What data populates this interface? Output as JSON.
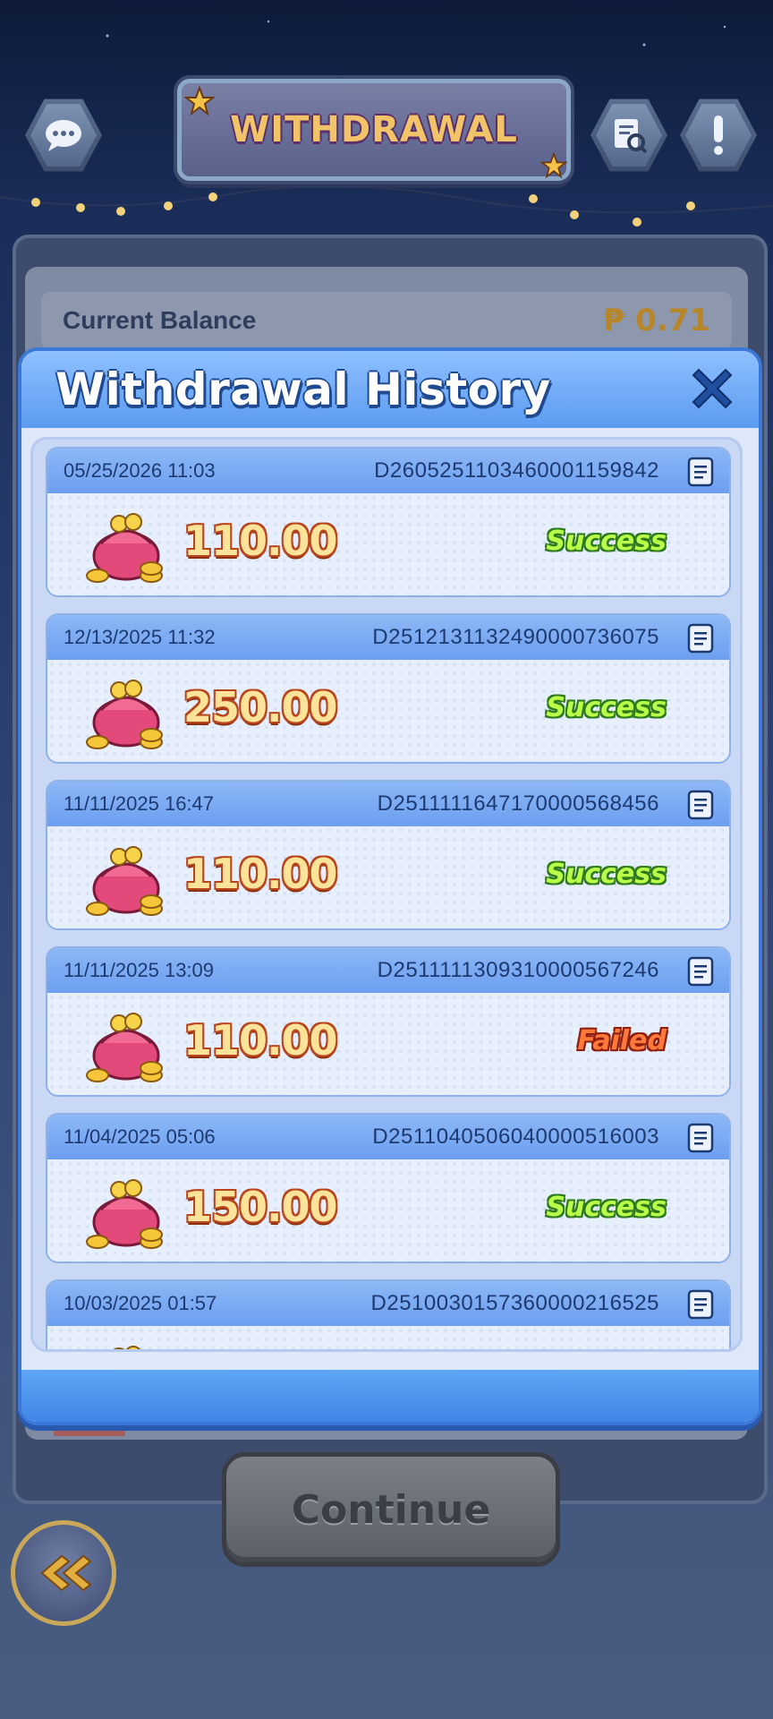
{
  "screen": {
    "title": "WITHDRAWAL",
    "balance_label": "Current Balance",
    "balance_value": "₱ 0.71",
    "continue_label": "Continue"
  },
  "modal": {
    "title": "Withdrawal History",
    "records": [
      {
        "date": "05/25/2026 11:03",
        "id": "D260525110346000115984​2",
        "amount": "110.00",
        "status": "Success"
      },
      {
        "date": "12/13/2025 11:32",
        "id": "D251213113249000073607​5",
        "amount": "250.00",
        "status": "Success"
      },
      {
        "date": "11/11/2025 16:47",
        "id": "D251111164717000056845​6",
        "amount": "110.00",
        "status": "Success"
      },
      {
        "date": "11/11/2025 13:09",
        "id": "D251111130931000056724​6",
        "amount": "110.00",
        "status": "Failed"
      },
      {
        "date": "11/04/2025 05:06",
        "id": "D251104050604000051600​3",
        "amount": "150.00",
        "status": "Success"
      },
      {
        "date": "10/03/2025 01:57",
        "id": "D251003015736000021652​5",
        "amount": "",
        "status": ""
      }
    ]
  },
  "icons": {
    "chat": "chat-bubble-icon",
    "records": "document-search-icon",
    "alert": "exclamation-icon",
    "close": "close-icon",
    "copy": "copy-document-icon",
    "purse": "coin-purse-icon",
    "back": "double-chevron-left-icon"
  },
  "colors": {
    "modal_accent": "#5b9bf0",
    "success": "#b9ff4a",
    "failed": "#ff7a3a",
    "amount": "#fbe39a"
  }
}
